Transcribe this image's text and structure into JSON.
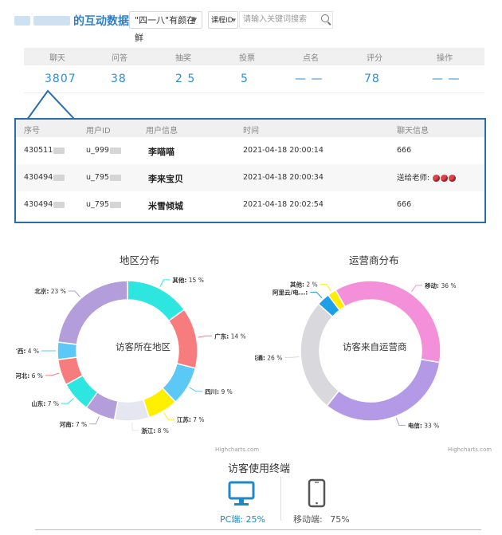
{
  "header": {
    "title": "的互动数据",
    "lesson_select": "\"四一八\"有颜在鲜",
    "course_select": "课程ID",
    "search_placeholder": "请输入关键词搜索"
  },
  "stats": {
    "headers": [
      "聊天",
      "问答",
      "抽奖",
      "投票",
      "点名",
      "评分",
      "操作"
    ],
    "values": [
      "3807",
      "38",
      "2 5",
      "5",
      "— —",
      "78",
      "— —"
    ]
  },
  "detail": {
    "headers": [
      "序号",
      "用户ID",
      "用户信息",
      "时间",
      "聊天信息"
    ],
    "rows": [
      {
        "no": "430511",
        "uid": "u_999",
        "name": "李喵喵",
        "time": "2021-04-18 20:00:14",
        "msg": "666"
      },
      {
        "no": "430494",
        "uid": "u_795",
        "name": "李来宝贝",
        "time": "2021-04-18 20:00:34",
        "msg": "送给老师:"
      },
      {
        "no": "430494",
        "uid": "u_795",
        "name": "米雪倾城",
        "time": "2021-04-18 20:02:54",
        "msg": "666"
      }
    ]
  },
  "chart_data": [
    {
      "type": "pie",
      "title": "地区分布",
      "center_label": "访客所在地区",
      "credit": "Highcharts.com",
      "categories": [
        "其他",
        "广东",
        "四川",
        "江苏",
        "浙江",
        "河南",
        "山东",
        "河北",
        "广西",
        "北京"
      ],
      "values": [
        15,
        14,
        9,
        7,
        8,
        7,
        7,
        6,
        4,
        23
      ],
      "colors": [
        "#2ee6e0",
        "#f77c7e",
        "#5bc8f5",
        "#fff000",
        "#e6e6f0",
        "#b39ddb",
        "#2ee6e0",
        "#f77c7e",
        "#5bc8f5",
        "#b39ddb"
      ]
    },
    {
      "type": "pie",
      "title": "运营商分布",
      "center_label": "访客来自运营商",
      "credit": "Highcharts.com",
      "categories": [
        "移动",
        "电信",
        "联通",
        "阿里云/电...",
        "其他"
      ],
      "values": [
        36,
        33,
        26,
        3,
        2
      ],
      "value_labels": [
        "36 %",
        "33 %",
        "26 %",
        "",
        "2 %"
      ],
      "colors": [
        "#f48fd9",
        "#b399e6",
        "#d9d9dd",
        "#1e9fe8",
        "#ffee00"
      ]
    }
  ],
  "terminal": {
    "title": "访客使用终端",
    "pc_label": "PC端:",
    "pc_value": "25%",
    "mobile_label": "移动端:",
    "mobile_value": "75%"
  }
}
